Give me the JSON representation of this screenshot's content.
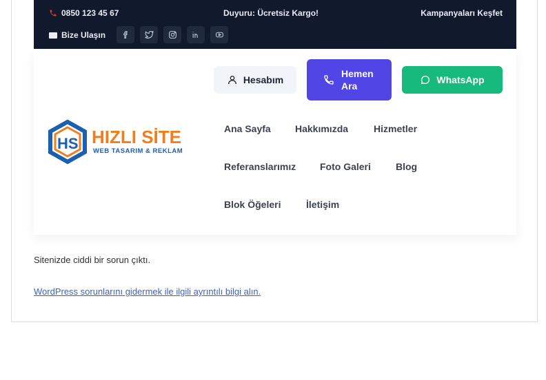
{
  "topbar": {
    "phone": "0850 123 45 67",
    "announcement": "Duyuru: Ücretsiz Kargo!",
    "campaign_link": "Kampanyaları Keşfet",
    "contact": "Bize Ulaşın",
    "socials": [
      "facebook-icon",
      "twitter-icon",
      "instagram-icon",
      "linkedin-icon",
      "youtube-icon"
    ]
  },
  "header": {
    "logo": {
      "title": "HIZLI SİTE",
      "subtitle": "WEB TASARIM & REKLAM",
      "monogram": "HS"
    },
    "buttons": {
      "account": "Hesabım",
      "call_line1": "Hemen",
      "call_line2": "Ara",
      "whatsapp": "WhatsApp"
    },
    "nav": [
      "Ana Sayfa",
      "Hakkımızda",
      "Hizmetler",
      "Referanslarımız",
      "Foto Galeri",
      "Blog",
      "Blok Öğeleri",
      "İletişim"
    ]
  },
  "content": {
    "error_message": "Sitenizde ciddi bir sorun çıktı.",
    "help_link": "WordPress sorunlarını gidermek ile ilgili ayrıntılı bilgi alın."
  },
  "colors": {
    "topbar_bg": "#111a2c",
    "call_button": "#5046e5",
    "whatsapp_button": "#17b97c",
    "link": "#3b63c4",
    "logo_orange": "#f07f1b",
    "logo_blue": "#1a5fb0"
  }
}
